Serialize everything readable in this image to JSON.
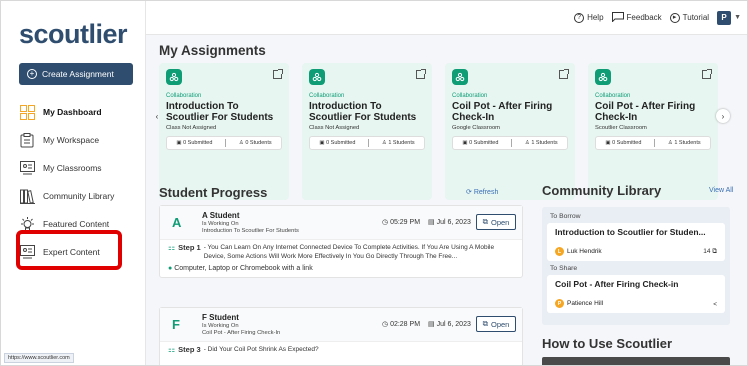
{
  "sidebar": {
    "logo": "scoutlier",
    "create_button": "Create Assignment",
    "items": [
      {
        "label": "My Dashboard",
        "active": true,
        "icon": "dashboard-icon"
      },
      {
        "label": "My Workspace",
        "active": false,
        "icon": "workspace-icon"
      },
      {
        "label": "My Classrooms",
        "active": false,
        "icon": "classroom-icon"
      },
      {
        "label": "Community Library",
        "active": false,
        "icon": "library-icon"
      },
      {
        "label": "Featured Content",
        "active": false,
        "icon": "featured-icon"
      },
      {
        "label": "Expert Content",
        "active": false,
        "icon": "expert-icon"
      }
    ],
    "status_url": "https://www.scoutlier.com"
  },
  "topbar": {
    "help": "Help",
    "feedback": "Feedback",
    "tutorial": "Tutorial",
    "avatar": "P"
  },
  "assignments": {
    "heading": "My Assignments",
    "cards": [
      {
        "category": "Collaboration",
        "title": "Introduction To Scoutlier For Students",
        "subtitle": "Class Not Assigned",
        "submitted": "0 Submitted",
        "students": "0 Students"
      },
      {
        "category": "Collaboration",
        "title": "Introduction To Scoutlier For Students",
        "subtitle": "Class Not Assigned",
        "submitted": "0 Submitted",
        "students": "1 Students"
      },
      {
        "category": "Collaboration",
        "title": "Coil Pot - After Firing Check-In",
        "subtitle": "Google Classroom",
        "submitted": "0 Submitted",
        "students": "1 Students"
      },
      {
        "category": "Collaboration",
        "title": "Coil Pot - After Firing Check-In",
        "subtitle": "Scoutlier Classroom",
        "submitted": "0 Submitted",
        "students": "1 Students"
      }
    ]
  },
  "progress": {
    "heading": "Student Progress",
    "refresh": "Refresh",
    "open_label": "Open",
    "students": [
      {
        "letter": "A",
        "name": "A Student",
        "status": "Is Working On",
        "course": "Introduction To Scoutlier For Students",
        "time": "05:29 PM",
        "date": "Jul 6, 2023",
        "step": "Step 1",
        "step_text": "- You Can Learn On Any Internet Connected Device To Complete Activities. If You Are Using A Mobile Device, Some Actions Will Work More Effectively In You Go Directly Through The Free...",
        "material": "Computer, Laptop or Chromebook with a link"
      },
      {
        "letter": "F",
        "name": "F Student",
        "status": "Is Working On",
        "course": "Coil Pot - After Firing Check-In",
        "time": "02:28 PM",
        "date": "Jul 6, 2023",
        "step": "Step 3",
        "step_text": "- Did Your Coil Pot Shrink As Expected?",
        "material": ""
      }
    ]
  },
  "community": {
    "heading": "Community Library",
    "view_all": "View All",
    "borrow_label": "To Borrow",
    "share_label": "To Share",
    "borrow": {
      "title": "Introduction to Scoutlier for Studen...",
      "author": "Luk Hendrik",
      "author_initial": "L",
      "count": "14"
    },
    "share": {
      "title": "Coil Pot - After Firing Check-in",
      "author": "Patience Hill",
      "author_initial": "P"
    }
  },
  "howto": {
    "heading": "How to Use Scoutlier"
  },
  "colors": {
    "brand": "#2f4d6e",
    "accent": "#0f9d76",
    "highlight": "#e00000"
  }
}
